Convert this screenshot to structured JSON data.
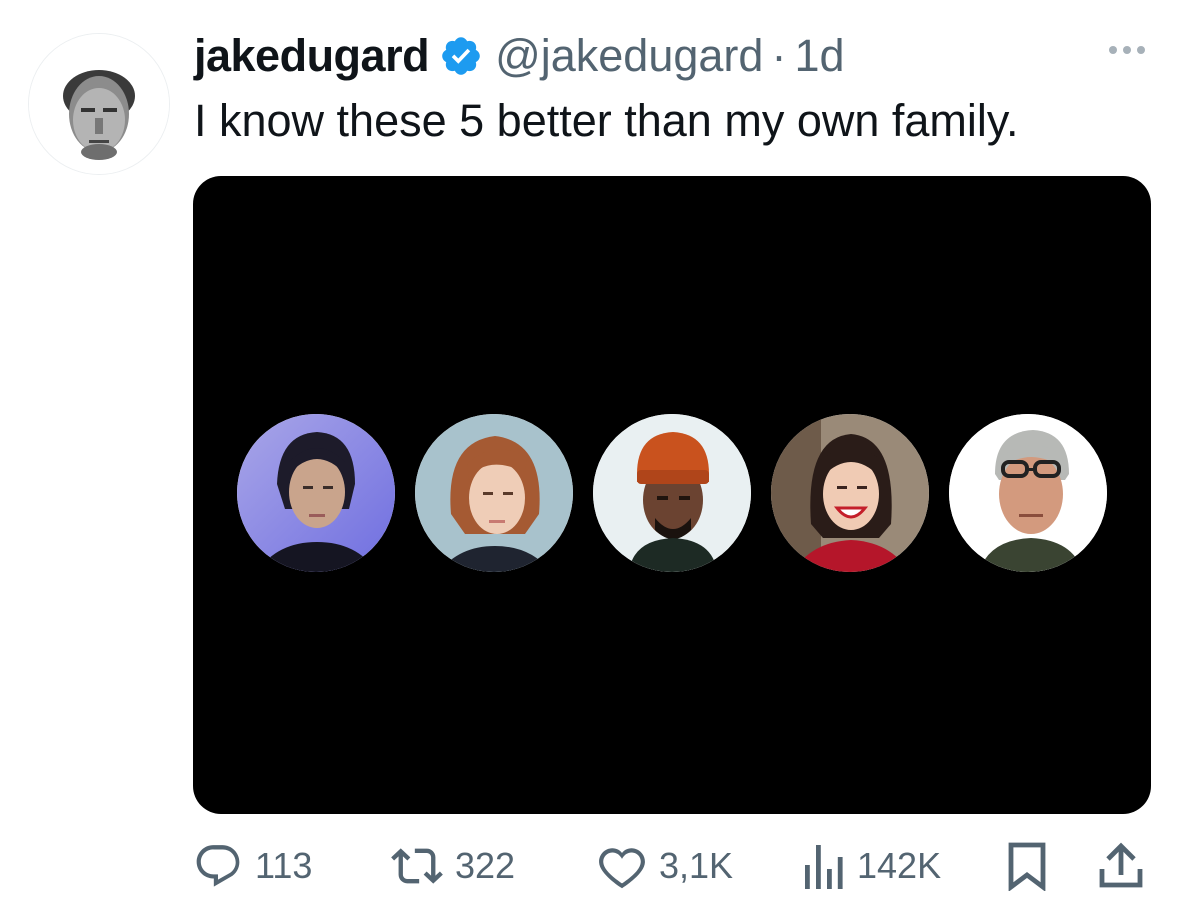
{
  "author": {
    "display_name": "jakedugard",
    "handle": "@jakedugard",
    "separator": "·",
    "time": "1d",
    "verified": true,
    "avatar_icon": "grayscale-portrait"
  },
  "tweet": {
    "text": "I know these 5 better than my own family."
  },
  "media": {
    "background": "#000000",
    "faces": [
      {
        "desc_icon": "portrait-woman-blue-light"
      },
      {
        "desc_icon": "portrait-woman-auburn-bob"
      },
      {
        "desc_icon": "portrait-man-orange-beanie"
      },
      {
        "desc_icon": "portrait-woman-smiling-red-top"
      },
      {
        "desc_icon": "portrait-man-glasses-gray-hair"
      }
    ]
  },
  "actions": {
    "reply": {
      "icon": "reply-icon",
      "count": "113"
    },
    "retweet": {
      "icon": "retweet-icon",
      "count": "322"
    },
    "like": {
      "icon": "heart-icon",
      "count": "3,1K"
    },
    "views": {
      "icon": "bar-chart-icon",
      "count": "142K"
    },
    "bookmark": {
      "icon": "bookmark-icon"
    },
    "share": {
      "icon": "share-icon"
    }
  },
  "colors": {
    "text_primary": "#0f1419",
    "text_secondary": "#536471",
    "verified_blue": "#1d9bf0"
  }
}
